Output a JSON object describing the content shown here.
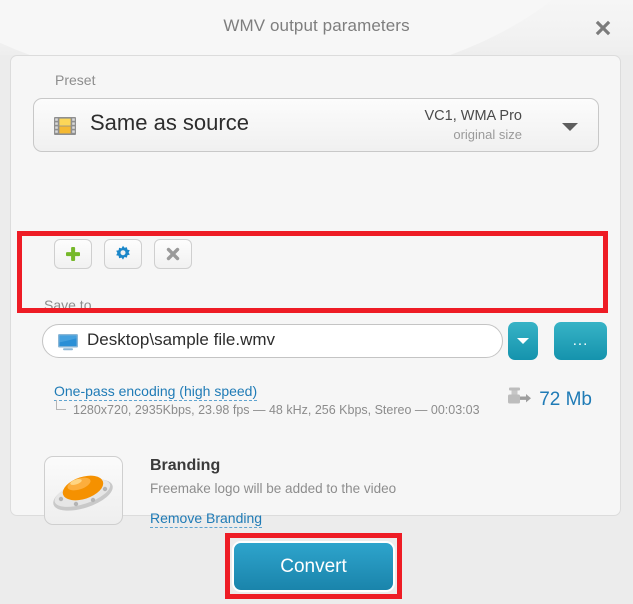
{
  "window": {
    "title": "WMV output parameters",
    "close_icon": "close-icon"
  },
  "preset": {
    "label": "Preset",
    "icon": "film-strip-icon",
    "name": "Same as source",
    "codec": "VC1, WMA Pro",
    "size": "original size",
    "dropdown_icon": "chevron-down-icon",
    "actions": [
      {
        "name": "add-preset-button",
        "icon": "plus-icon",
        "color": "#76b82a"
      },
      {
        "name": "edit-preset-button",
        "icon": "gear-icon",
        "color": "#1b87c9"
      },
      {
        "name": "delete-preset-button",
        "icon": "close-x-icon",
        "color": "#9a9a9a"
      }
    ]
  },
  "save_to": {
    "label": "Save to",
    "icon": "monitor-icon",
    "path": "Desktop\\sample file.wmv",
    "placeholder": "Desktop\\sample file.wmv",
    "dropdown_icon": "chevron-down-icon",
    "browse_label": "...",
    "accent_color": "#1593ad"
  },
  "encoding": {
    "link": "One-pass encoding (high speed)",
    "details": "1280x720, 2935Kbps, 23.98 fps — 48 kHz, 256 Kbps, Stereo — 00:03:03",
    "link_color": "#1f7bb6"
  },
  "file_size": {
    "icon": "compress-export-icon",
    "value": "72 Mb",
    "color": "#1f7bb6"
  },
  "branding": {
    "icon": "ufo-logo-icon",
    "title": "Branding",
    "description": "Freemake logo will be added to the video",
    "remove_link": "Remove Branding"
  },
  "footer": {
    "convert_label": "Convert",
    "convert_color": "#1a84ab"
  },
  "annotations": {
    "color": "#ee1c25",
    "highlights": [
      "save-to-row",
      "convert-button"
    ]
  }
}
